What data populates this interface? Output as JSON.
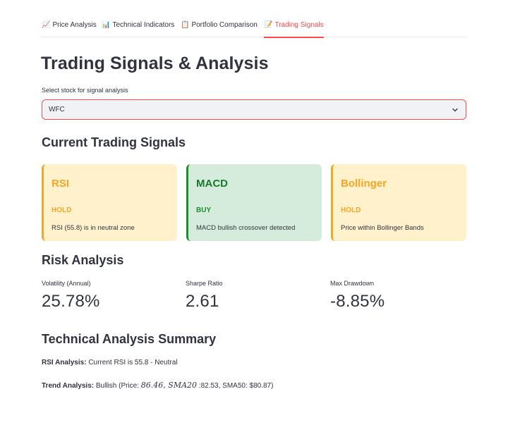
{
  "tabs": [
    {
      "icon": "📈",
      "label": "Price Analysis"
    },
    {
      "icon": "📊",
      "label": "Technical Indicators"
    },
    {
      "icon": "📋",
      "label": "Portfolio Comparison"
    },
    {
      "icon": "📝",
      "label": "Trading Signals"
    }
  ],
  "active_tab": "Trading Signals",
  "page_title": "Trading Signals & Analysis",
  "stock_select": {
    "label": "Select stock for signal analysis",
    "value": "WFC"
  },
  "signals_heading": "Current Trading Signals",
  "signals": [
    {
      "name": "RSI",
      "status": "HOLD",
      "description": "RSI (55.8) is in neutral zone",
      "color": "#f5a623"
    },
    {
      "name": "MACD",
      "status": "BUY",
      "description": "MACD bullish crossover detected",
      "color": "#1a8f2e"
    },
    {
      "name": "Bollinger",
      "status": "HOLD",
      "description": "Price within Bollinger Bands",
      "color": "#f5a623"
    }
  ],
  "risk_heading": "Risk Analysis",
  "metrics": [
    {
      "label": "Volatility (Annual)",
      "value": "25.78%"
    },
    {
      "label": "Sharpe Ratio",
      "value": "2.61"
    },
    {
      "label": "Max Drawdown",
      "value": "-8.85%"
    }
  ],
  "tech_heading": "Technical Analysis Summary",
  "rsi_analysis": {
    "label": "RSI Analysis:",
    "text": "Current RSI is 55.8 - Neutral"
  },
  "trend_analysis": {
    "label": "Trend Analysis:",
    "prefix": "Bullish (Price: ",
    "math": "86.46, SMA20",
    "suffix": ":82.53, SMA50: $80.87)"
  },
  "accent_color": "#ff4b4b"
}
